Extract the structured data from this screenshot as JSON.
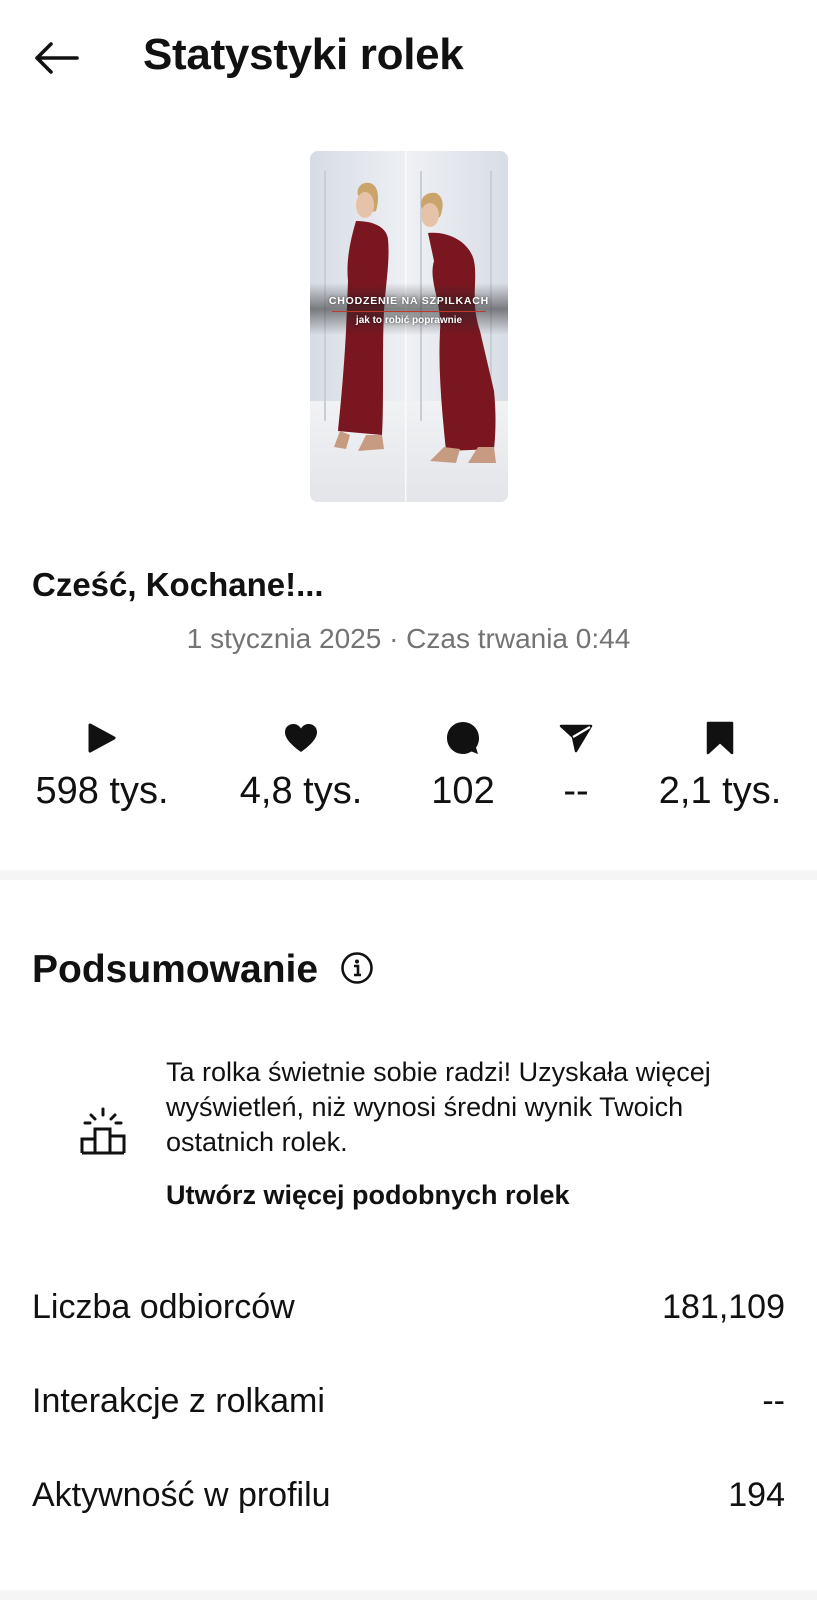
{
  "header": {
    "title": "Statystyki rolek",
    "back_icon": "arrow-left-icon"
  },
  "reel": {
    "thumbnail_title": "CHODZENIE NA SZPILKACH",
    "thumbnail_subtitle": "jak to robić poprawnie",
    "caption": "Cześć, Kochane!...",
    "meta": "1 stycznia 2025 · Czas trwania 0:44"
  },
  "stats": [
    {
      "icon": "play-icon",
      "value": "598 tys."
    },
    {
      "icon": "heart-icon",
      "value": "4,8 tys."
    },
    {
      "icon": "comment-icon",
      "value": "102"
    },
    {
      "icon": "share-icon",
      "value": "--"
    },
    {
      "icon": "bookmark-icon",
      "value": "2,1 tys."
    }
  ],
  "summary": {
    "title": "Podsumowanie",
    "info_icon": "info-icon",
    "insight_icon": "podium-icon",
    "insight_text": "Ta rolka świetnie sobie radzi! Uzyskała więcej wyświetleń, niż wynosi średni wynik Twoich ostatnich rolek.",
    "insight_link": "Utwórz więcej podobnych rolek"
  },
  "metrics": [
    {
      "label": "Liczba odbiorców",
      "value": "181,109"
    },
    {
      "label": "Interakcje z rolkami",
      "value": "--"
    },
    {
      "label": "Aktywność w profilu",
      "value": "194"
    }
  ],
  "colors": {
    "text": "#111111",
    "secondary": "#737373",
    "dress": "#7a1620",
    "divider": "#f5f5f5"
  }
}
